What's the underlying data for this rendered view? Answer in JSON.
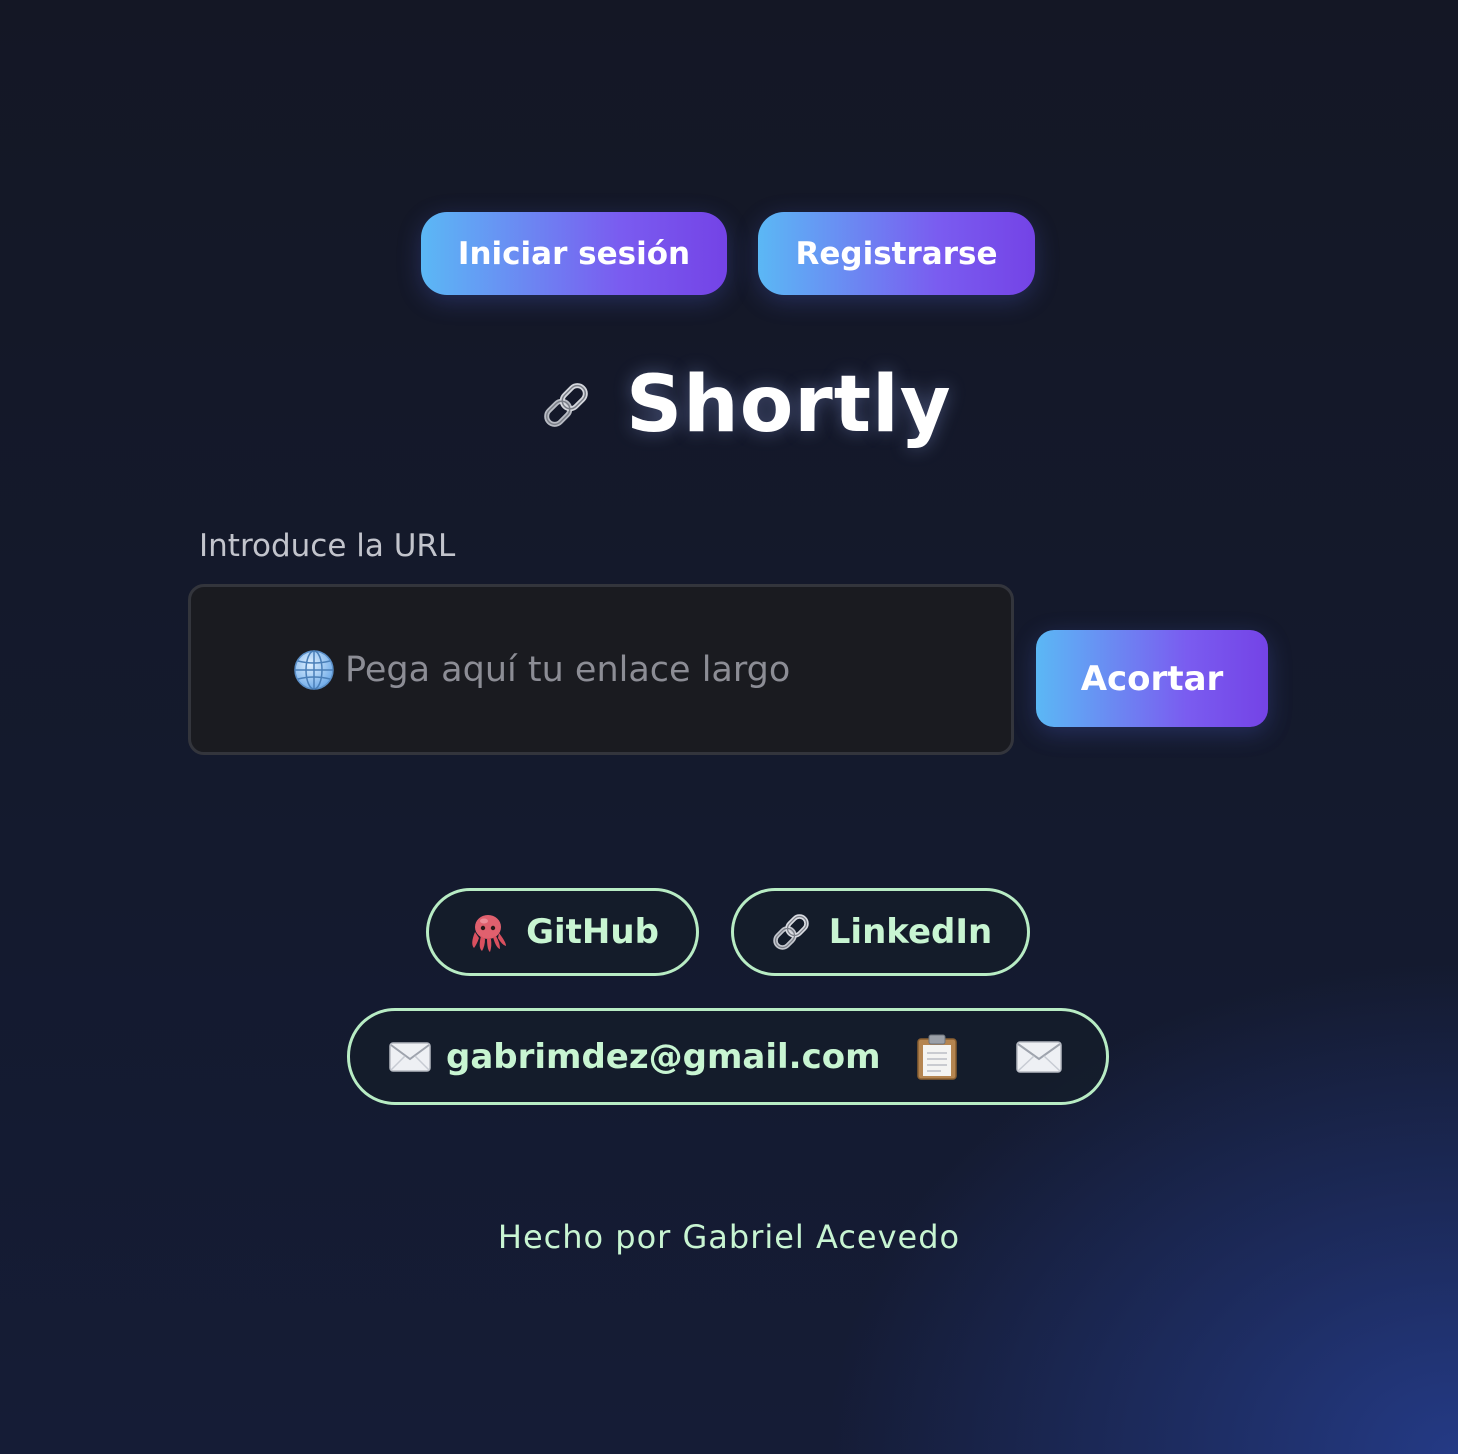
{
  "header": {
    "login_label": "Iniciar sesión",
    "register_label": "Registrarse"
  },
  "brand": {
    "title": "Shortly",
    "icon": "link-icon"
  },
  "form": {
    "label": "Introduce la URL",
    "placeholder": "Pega aquí tu enlace largo",
    "input_icon": "globe-icon",
    "submit_label": "Acortar"
  },
  "links": {
    "github_label": "GitHub",
    "github_icon": "octopus-icon",
    "linkedin_label": "LinkedIn",
    "linkedin_icon": "link-icon",
    "email": "gabrimdez@gmail.com",
    "email_icon": "envelope-icon",
    "copy_icon": "clipboard-icon"
  },
  "footer": {
    "text": "Hecho por Gabriel Acevedo"
  },
  "colors": {
    "accent_start": "#5bb8f5",
    "accent_end": "#7443e6",
    "pill_border": "#b8ecc4",
    "pill_text": "#c8f5d2",
    "background": "#141725"
  }
}
